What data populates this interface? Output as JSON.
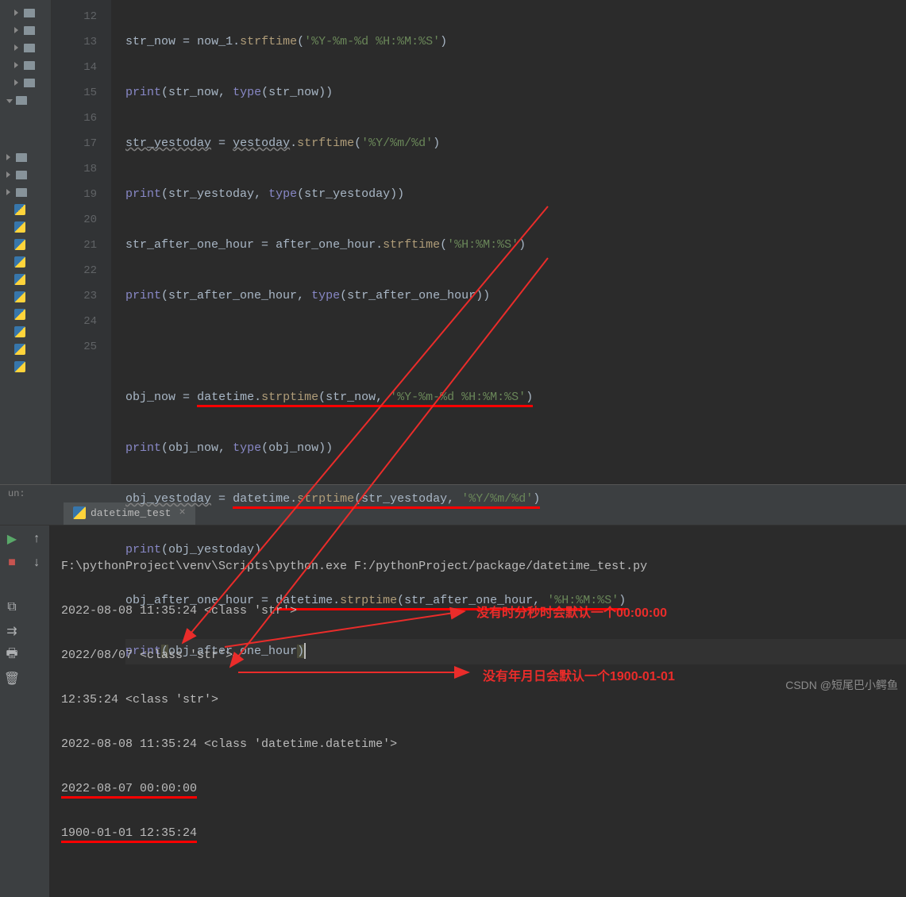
{
  "editor": {
    "lines": [
      {
        "num": "12",
        "content": "str_now_assign"
      },
      {
        "num": "13",
        "content": "print_str_now"
      },
      {
        "num": "14",
        "content": "str_yestoday_assign"
      },
      {
        "num": "15",
        "content": "print_str_yestoday"
      },
      {
        "num": "16",
        "content": "str_after_assign"
      },
      {
        "num": "17",
        "content": "print_str_after"
      },
      {
        "num": "18",
        "content": ""
      },
      {
        "num": "19",
        "content": "obj_now_assign"
      },
      {
        "num": "20",
        "content": "print_obj_now"
      },
      {
        "num": "21",
        "content": "obj_yestoday_assign"
      },
      {
        "num": "22",
        "content": "print_obj_yestoday"
      },
      {
        "num": "23",
        "content": "obj_after_assign"
      },
      {
        "num": "24",
        "content": "print_obj_after"
      },
      {
        "num": "25",
        "content": ""
      }
    ],
    "code": {
      "l12_var": "str_now",
      "l12_expr": "now_1",
      "l12_method": "strftime",
      "l12_arg": "'%Y-%m-%d %H:%M:%S'",
      "l13_fn": "print",
      "l13_a1": "str_now",
      "l13_type": "type",
      "l13_a2": "str_now",
      "l14_var": "str_yestoday",
      "l14_expr": "yestoday",
      "l14_method": "strftime",
      "l14_arg": "'%Y/%m/%d'",
      "l15_fn": "print",
      "l15_a1": "str_yestoday",
      "l15_type": "type",
      "l15_a2": "str_yestoday",
      "l16_var": "str_after_one_hour",
      "l16_expr": "after_one_hour",
      "l16_method": "strftime",
      "l16_arg": "'%H:%M:%S'",
      "l17_fn": "print",
      "l17_a1": "str_after_one_hour",
      "l17_type": "type",
      "l17_a2": "str_after_one_hour",
      "l19_var": "obj_now",
      "l19_mod": "datetime",
      "l19_method": "strptime",
      "l19_a1": "str_now",
      "l19_a2": "'%Y-%m-%d %H:%M:%S'",
      "l20_fn": "print",
      "l20_a1": "obj_now",
      "l20_type": "type",
      "l20_a2": "obj_now",
      "l21_var": "obj_yestoday",
      "l21_mod": "datetime",
      "l21_method": "strptime",
      "l21_a1": "str_yestoday",
      "l21_a2": "'%Y/%m/%d'",
      "l22_fn": "print",
      "l22_a1": "obj_yestoday",
      "l23_var": "obj_after_one_hour",
      "l23_mod": "datetime",
      "l23_method": "strptime",
      "l23_a1": "str_after_one_hour",
      "l23_a2": "'%H:%M:%S'",
      "l24_fn": "print",
      "l24_a1": "obj_after_one_hour"
    }
  },
  "run": {
    "label": "un:",
    "tab_name": "datetime_test",
    "output": {
      "line1": "F:\\pythonProject\\venv\\Scripts\\python.exe F:/pythonProject/package/datetime_test.py",
      "line2": "2022-08-08 11:35:24 <class 'str'>",
      "line3": "2022/08/07 <class 'str'>",
      "line4": "12:35:24 <class 'str'>",
      "line5": "2022-08-08 11:35:24 <class 'datetime.datetime'>",
      "line6": "2022-08-07 00:00:00",
      "line7": "1900-01-01 12:35:24"
    }
  },
  "annotations": {
    "note1": "没有时分秒时会默认一个00:00:00",
    "note2": "没有年月日会默认一个1900-01-01"
  },
  "watermark": "CSDN @短尾巴小鳄鱼"
}
